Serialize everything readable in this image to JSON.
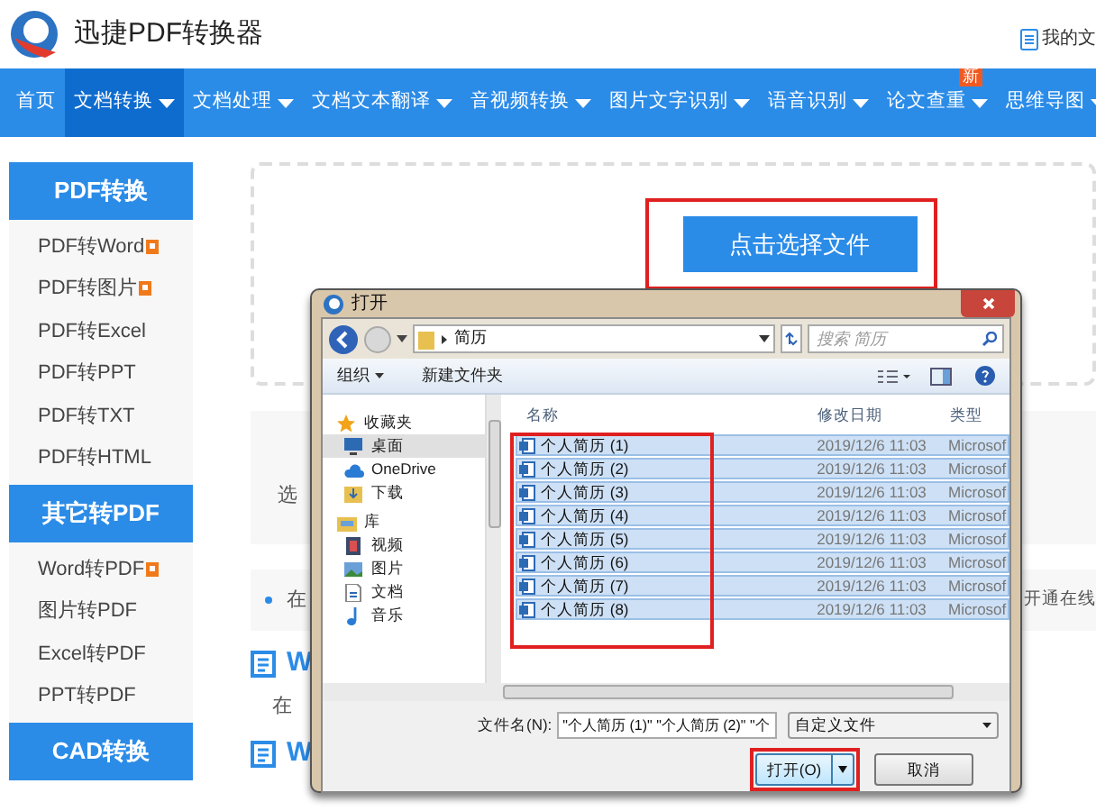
{
  "header": {
    "app_title": "迅捷PDF转换器",
    "my_files": "我的文"
  },
  "nav": [
    {
      "label": "首页",
      "selected": false,
      "dropdown": false
    },
    {
      "label": "文档转换",
      "selected": true,
      "dropdown": true
    },
    {
      "label": "文档处理",
      "selected": false,
      "dropdown": true
    },
    {
      "label": "文档文本翻译",
      "selected": false,
      "dropdown": true
    },
    {
      "label": "音视频转换",
      "selected": false,
      "dropdown": true
    },
    {
      "label": "图片文字识别",
      "selected": false,
      "dropdown": true
    },
    {
      "label": "语音识别",
      "selected": false,
      "dropdown": true
    },
    {
      "label": "论文查重",
      "selected": false,
      "dropdown": true,
      "badge": "新"
    },
    {
      "label": "思维导图",
      "selected": false,
      "dropdown": true
    }
  ],
  "sidebar": [
    {
      "title": "PDF转换",
      "items": [
        {
          "label": "PDF转Word",
          "hot": true
        },
        {
          "label": "PDF转图片",
          "hot": true
        },
        {
          "label": "PDF转Excel",
          "hot": false
        },
        {
          "label": "PDF转PPT",
          "hot": false
        },
        {
          "label": "PDF转TXT",
          "hot": false
        },
        {
          "label": "PDF转HTML",
          "hot": false
        }
      ]
    },
    {
      "title": "其它转PDF",
      "items": [
        {
          "label": "Word转PDF",
          "hot": true
        },
        {
          "label": "图片转PDF",
          "hot": false
        },
        {
          "label": "Excel转PDF",
          "hot": false
        },
        {
          "label": "PPT转PDF",
          "hot": false
        }
      ]
    },
    {
      "title": "CAD转换"
    }
  ],
  "upload": {
    "button": "点击选择文件"
  },
  "main": {
    "select_text": "选",
    "bullet_text": "在",
    "bullet_right": "开通在线",
    "sections": [
      {
        "heading": "W",
        "text": "在"
      },
      {
        "heading": "W"
      }
    ]
  },
  "dialog": {
    "title": "打开",
    "path": "简历",
    "search_placeholder": "搜索 简历",
    "toolbar": {
      "organize": "组织",
      "new_folder": "新建文件夹"
    },
    "nav_pane": [
      {
        "label": "收藏夹",
        "kind": "star",
        "selected": false,
        "group": true
      },
      {
        "label": "桌面",
        "kind": "desktop",
        "selected": true,
        "group": false
      },
      {
        "label": "OneDrive",
        "kind": "cloud",
        "selected": false,
        "group": false
      },
      {
        "label": "下载",
        "kind": "download",
        "selected": false,
        "group": false
      },
      {
        "label": "库",
        "kind": "library",
        "selected": false,
        "group": true
      },
      {
        "label": "视频",
        "kind": "video",
        "selected": false,
        "group": false
      },
      {
        "label": "图片",
        "kind": "picture",
        "selected": false,
        "group": false
      },
      {
        "label": "文档",
        "kind": "document",
        "selected": false,
        "group": false
      },
      {
        "label": "音乐",
        "kind": "music",
        "selected": false,
        "group": false
      }
    ],
    "columns": [
      "名称",
      "修改日期",
      "类型"
    ],
    "files": [
      {
        "name": "个人简历 (1)",
        "date": "2019/12/6 11:03",
        "type": "Microsof",
        "selected": true
      },
      {
        "name": "个人简历 (2)",
        "date": "2019/12/6 11:03",
        "type": "Microsof",
        "selected": true
      },
      {
        "name": "个人简历 (3)",
        "date": "2019/12/6 11:03",
        "type": "Microsof",
        "selected": true
      },
      {
        "name": "个人简历 (4)",
        "date": "2019/12/6 11:03",
        "type": "Microsof",
        "selected": true
      },
      {
        "name": "个人简历 (5)",
        "date": "2019/12/6 11:03",
        "type": "Microsof",
        "selected": true
      },
      {
        "name": "个人简历 (6)",
        "date": "2019/12/6 11:03",
        "type": "Microsof",
        "selected": true
      },
      {
        "name": "个人简历 (7)",
        "date": "2019/12/6 11:03",
        "type": "Microsof",
        "selected": true
      },
      {
        "name": "个人简历 (8)",
        "date": "2019/12/6 11:03",
        "type": "Microsof",
        "selected": true
      }
    ],
    "filename_label": "文件名(N):",
    "filename_value": "\"个人简历 (1)\" \"个人简历 (2)\" \"个",
    "filetype": "自定义文件",
    "open_button": "打开(O)",
    "cancel_button": "取消"
  }
}
